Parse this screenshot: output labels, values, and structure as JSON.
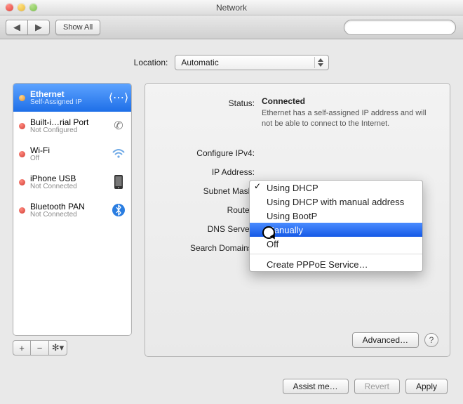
{
  "window": {
    "title": "Network"
  },
  "toolbar": {
    "show_all": "Show All",
    "search_placeholder": ""
  },
  "location": {
    "label": "Location:",
    "value": "Automatic"
  },
  "sidebar": {
    "items": [
      {
        "name": "Ethernet",
        "sub": "Self-Assigned IP",
        "status": "orange",
        "icon": "ethernet"
      },
      {
        "name": "Built-i…rial Port",
        "sub": "Not Configured",
        "status": "red",
        "icon": "phone"
      },
      {
        "name": "Wi-Fi",
        "sub": "Off",
        "status": "red",
        "icon": "wifi"
      },
      {
        "name": "iPhone USB",
        "sub": "Not Connected",
        "status": "red",
        "icon": "iphone"
      },
      {
        "name": "Bluetooth PAN",
        "sub": "Not Connected",
        "status": "red",
        "icon": "bluetooth"
      }
    ]
  },
  "labels": {
    "status": "Status:",
    "configure_ipv4": "Configure IPv4:",
    "ip_address": "IP Address:",
    "subnet_mask": "Subnet Mask:",
    "router": "Router:",
    "dns_server": "DNS Server:",
    "search_domains": "Search Domains:"
  },
  "status": {
    "value": "Connected",
    "desc": "Ethernet has a self-assigned IP address and will not be able to connect to the Internet."
  },
  "ipv4_menu": {
    "options": [
      "Using DHCP",
      "Using DHCP with manual address",
      "Using BootP",
      "Manually",
      "Off",
      "Create PPPoE Service…"
    ],
    "current_index": 0,
    "highlighted_index": 3
  },
  "buttons": {
    "advanced": "Advanced…",
    "assist": "Assist me…",
    "revert": "Revert",
    "apply": "Apply"
  }
}
